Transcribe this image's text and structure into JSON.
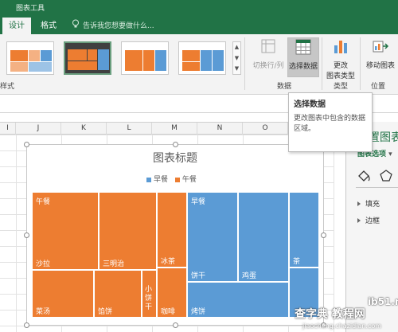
{
  "ribbon": {
    "tool_label": "图表工具",
    "tabs": {
      "design": "设计",
      "format": "格式"
    },
    "tell_me": "告诉我您想要做什么...",
    "styles_group": "样式",
    "buttons": {
      "switch_row_col": "切换行/列",
      "select_data": "选择数据",
      "change_type_line1": "更改",
      "change_type_line2": "图表类型",
      "move_chart": "移动图表"
    },
    "groups": {
      "data": "数据",
      "type": "类型",
      "location": "位置"
    }
  },
  "columns": [
    "I",
    "J",
    "K",
    "L",
    "M",
    "N",
    "O"
  ],
  "tooltip": {
    "title": "选择数据",
    "description": "更改图表中包含的数据区域。"
  },
  "chart": {
    "title": "图表标题",
    "legend": [
      {
        "label": "早餐",
        "color": "#5b9bd5"
      },
      {
        "label": "午餐",
        "color": "#ed7d31"
      }
    ]
  },
  "chart_data": {
    "type": "treemap",
    "title": "图表标题",
    "legend_position": "top",
    "series": [
      {
        "name": "午餐",
        "color": "#ed7d31",
        "categories": [
          "沙拉",
          "三明治",
          "冰茶",
          "菜汤",
          "馅饼",
          "小饼干",
          "咖啡"
        ]
      },
      {
        "name": "早餐",
        "color": "#5b9bd5",
        "categories": [
          "饼干",
          "鸡蛋",
          "茶",
          "烤饼"
        ]
      }
    ],
    "tile_labels": {
      "lunch": [
        "沙拉",
        "三明治",
        "冰茶",
        "菜汤",
        "馅饼",
        "小饼干",
        "咖啡"
      ],
      "breakfast": [
        "饼干",
        "鸡蛋",
        "茶",
        "烤饼"
      ]
    },
    "group_labels": {
      "lunch": "午餐",
      "breakfast": "早餐"
    }
  },
  "pane": {
    "title": "设置图表",
    "subtitle": "图表选项",
    "items": [
      "填充",
      "边框"
    ]
  },
  "watermark": {
    "top": "ib51.net",
    "middle": "查字典 教程网",
    "bottom": "jiaocheng.chazidian.com"
  }
}
